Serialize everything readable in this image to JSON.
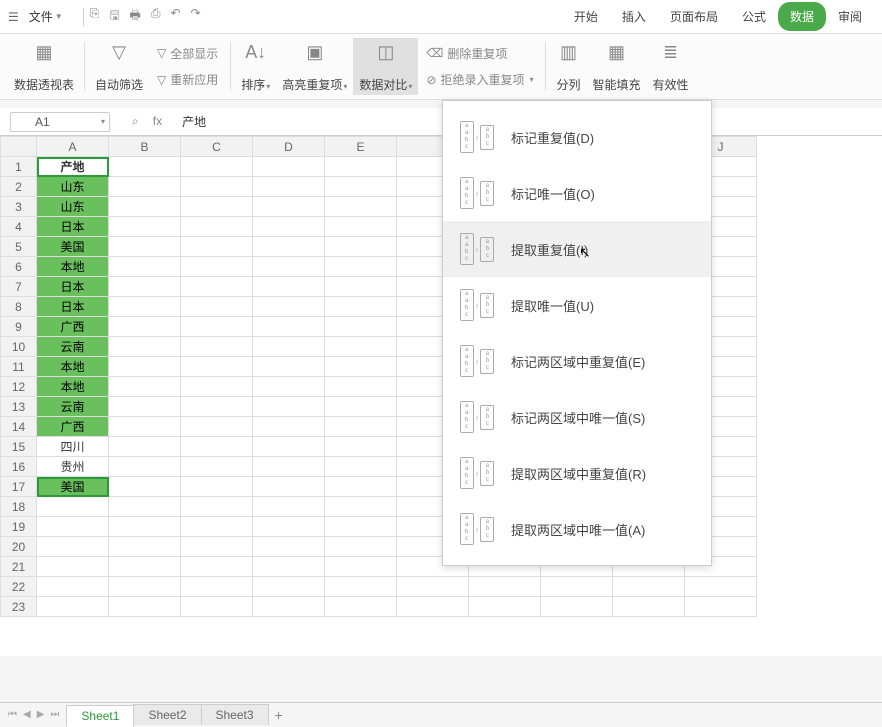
{
  "menubar": {
    "file": "文件",
    "tabs": [
      "开始",
      "插入",
      "页面布局",
      "公式",
      "数据",
      "审阅"
    ],
    "active_tab": "数据"
  },
  "ribbon": {
    "pivot": "数据透视表",
    "filter": "自动筛选",
    "show_all": "全部显示",
    "reapply": "重新应用",
    "sort": "排序",
    "highlight_dup": "高亮重复项",
    "compare": "数据对比",
    "del_dup": "删除重复项",
    "reject_dup": "拒绝录入重复项",
    "text_to_col": "分列",
    "smart_fill": "智能填充",
    "validation": "有效性"
  },
  "dropdown": {
    "items": [
      {
        "label": "标记重复值(D)"
      },
      {
        "label": "标记唯一值(O)"
      },
      {
        "label": "提取重复值(I)"
      },
      {
        "label": "提取唯一值(U)"
      },
      {
        "label": "标记两区域中重复值(E)"
      },
      {
        "label": "标记两区域中唯一值(S)"
      },
      {
        "label": "提取两区域中重复值(R)"
      },
      {
        "label": "提取两区域中唯一值(A)"
      }
    ],
    "hovered_index": 2
  },
  "formula": {
    "name_box": "A1",
    "fx": "fx",
    "value": "产地"
  },
  "grid": {
    "columns": [
      "A",
      "B",
      "C",
      "D",
      "E",
      "",
      "",
      "",
      "",
      "J"
    ],
    "data": [
      {
        "v": "产地",
        "style": "header-cell"
      },
      {
        "v": "山东",
        "style": "green"
      },
      {
        "v": "山东",
        "style": "green"
      },
      {
        "v": "日本",
        "style": "green"
      },
      {
        "v": "美国",
        "style": "green"
      },
      {
        "v": "本地",
        "style": "green"
      },
      {
        "v": "日本",
        "style": "green"
      },
      {
        "v": "日本",
        "style": "green"
      },
      {
        "v": "广西",
        "style": "green"
      },
      {
        "v": "云南",
        "style": "green"
      },
      {
        "v": "本地",
        "style": "green"
      },
      {
        "v": "本地",
        "style": "green"
      },
      {
        "v": "云南",
        "style": "green"
      },
      {
        "v": "广西",
        "style": "green"
      },
      {
        "v": "四川",
        "style": "plain"
      },
      {
        "v": "贵州",
        "style": "plain"
      },
      {
        "v": "美国",
        "style": "green"
      }
    ],
    "total_rows": 23
  },
  "sheets": {
    "tabs": [
      "Sheet1",
      "Sheet2",
      "Sheet3"
    ],
    "active": 0
  }
}
